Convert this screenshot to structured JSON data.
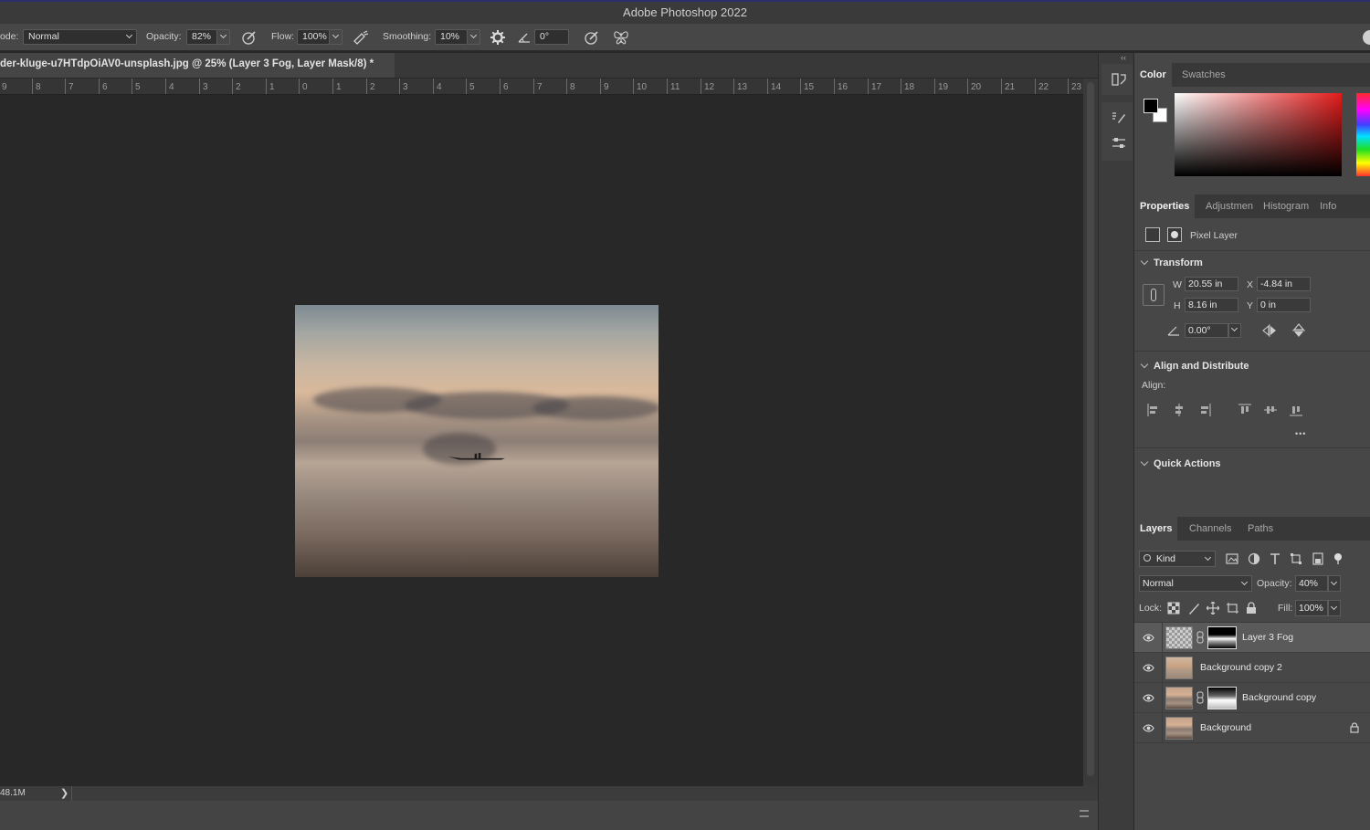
{
  "app": {
    "title": "Adobe Photoshop 2022"
  },
  "options": {
    "mode_label": "ode:",
    "mode_value": "Normal",
    "opacity_label": "Opacity:",
    "opacity_value": "82%",
    "flow_label": "Flow:",
    "flow_value": "100%",
    "smoothing_label": "Smoothing:",
    "smoothing_value": "10%",
    "angle_value": "0°"
  },
  "document": {
    "tab_title": "der-kluge-u7HTdpOiAV0-unsplash.jpg @ 25% (Layer 3 Fog, Layer Mask/8) *",
    "doc_size": "48.1M",
    "status_arrow": "❯"
  },
  "ruler": {
    "labels": [
      "9",
      "8",
      "7",
      "6",
      "5",
      "4",
      "3",
      "2",
      "1",
      "0",
      "1",
      "2",
      "3",
      "4",
      "5",
      "6",
      "7",
      "8",
      "9",
      "10",
      "11",
      "12",
      "13",
      "14",
      "15",
      "16",
      "17",
      "18",
      "19",
      "20",
      "21",
      "22",
      "23"
    ]
  },
  "color_panel": {
    "tabs": [
      "Color",
      "Swatches"
    ],
    "foreground": "#000000",
    "background": "#ffffff"
  },
  "properties_panel": {
    "tabs": [
      "Properties",
      "Adjustmen",
      "Histogram",
      "Info"
    ],
    "layer_type": "Pixel Layer",
    "transform": {
      "heading": "Transform",
      "w_label": "W",
      "w_value": "20.55 in",
      "x_label": "X",
      "x_value": "-4.84 in",
      "h_label": "H",
      "h_value": "8.16 in",
      "y_label": "Y",
      "y_value": "0 in",
      "angle_value": "0.00°"
    },
    "align": {
      "heading": "Align and Distribute",
      "label": "Align:",
      "more": "•••"
    },
    "quick_actions": {
      "heading": "Quick Actions"
    }
  },
  "layers_panel": {
    "tabs": [
      "Layers",
      "Channels",
      "Paths"
    ],
    "filter_kind": "Kind",
    "blend_mode": "Normal",
    "opacity_label": "Opacity:",
    "opacity_value": "40%",
    "lock_label": "Lock:",
    "fill_label": "Fill:",
    "fill_value": "100%",
    "layers": [
      {
        "name": "Layer 3 Fog",
        "has_mask": true,
        "selected": true
      },
      {
        "name": "Background copy 2",
        "has_mask": false,
        "selected": false
      },
      {
        "name": "Background copy",
        "has_mask": true,
        "selected": false
      },
      {
        "name": "Background",
        "has_mask": false,
        "selected": false,
        "locked": true
      }
    ]
  },
  "icons": {
    "brush_pressure": "pressure-opacity-icon",
    "airbrush": "airbrush-icon",
    "settings": "gear-icon",
    "angle": "angle-icon",
    "pressure_size": "pressure-size-icon",
    "symmetry": "butterfly-symmetry-icon",
    "visibility": "eye-icon",
    "lock": "lock-icon",
    "chain": "link-chain-icon"
  }
}
